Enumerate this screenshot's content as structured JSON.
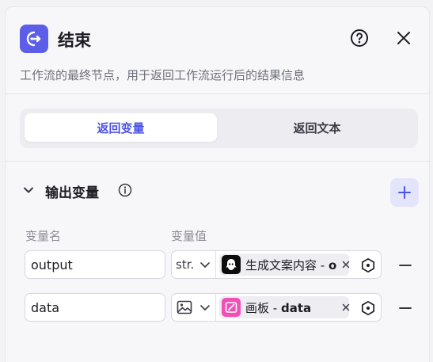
{
  "header": {
    "title": "结束",
    "description": "工作流的最终节点，用于返回工作流运行后的结果信息"
  },
  "tabs": [
    {
      "label": "返回变量",
      "active": true
    },
    {
      "label": "返回文本",
      "active": false
    }
  ],
  "output_section": {
    "title": "输出变量",
    "columns": {
      "name": "变量名",
      "value": "变量值"
    },
    "rows": [
      {
        "name": "output",
        "type_label": "str.",
        "source_node": "生成文案内容",
        "separator": " - ",
        "source_var": "o",
        "chip_icon": "bot-icon",
        "chip_color": "#0d0d0d"
      },
      {
        "name": "data",
        "type_label": "",
        "type_icon": "image-icon",
        "source_node": "画板",
        "separator": " - ",
        "source_var": "data",
        "chip_icon": "canvas-icon",
        "chip_color": "#f24fb5"
      }
    ]
  },
  "colors": {
    "accent": "#4d53e8",
    "node_icon_bg": "#5d5ee8",
    "add_button_bg": "#e4e5fb"
  }
}
